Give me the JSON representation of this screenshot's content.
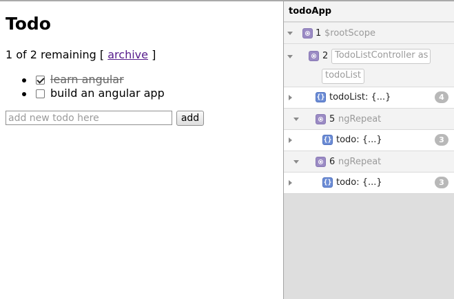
{
  "app": {
    "title": "Todo",
    "remaining": {
      "count_text": "1 of 2 remaining [ ",
      "archive_label": "archive",
      "close": " ]"
    },
    "todos": [
      {
        "text": "learn angular",
        "done": true
      },
      {
        "text": "build an angular app",
        "done": false
      }
    ],
    "input_placeholder": "add new todo here",
    "add_label": "add"
  },
  "inspector": {
    "title": "todoApp",
    "rows": [
      {
        "type": "scope",
        "id": "1",
        "name": "$rootScope"
      },
      {
        "type": "scope",
        "id": "2",
        "controller_line1": "TodoListController as",
        "controller_line2": "todoList"
      },
      {
        "type": "object",
        "label": "todoList: {...}",
        "badge": "4"
      },
      {
        "type": "scope",
        "id": "5",
        "name": "ngRepeat"
      },
      {
        "type": "object",
        "label": "todo: {...}",
        "badge": "3"
      },
      {
        "type": "scope",
        "id": "6",
        "name": "ngRepeat"
      },
      {
        "type": "object",
        "label": "todo: {...}",
        "badge": "3"
      }
    ],
    "object_icon_glyph": "{}"
  }
}
